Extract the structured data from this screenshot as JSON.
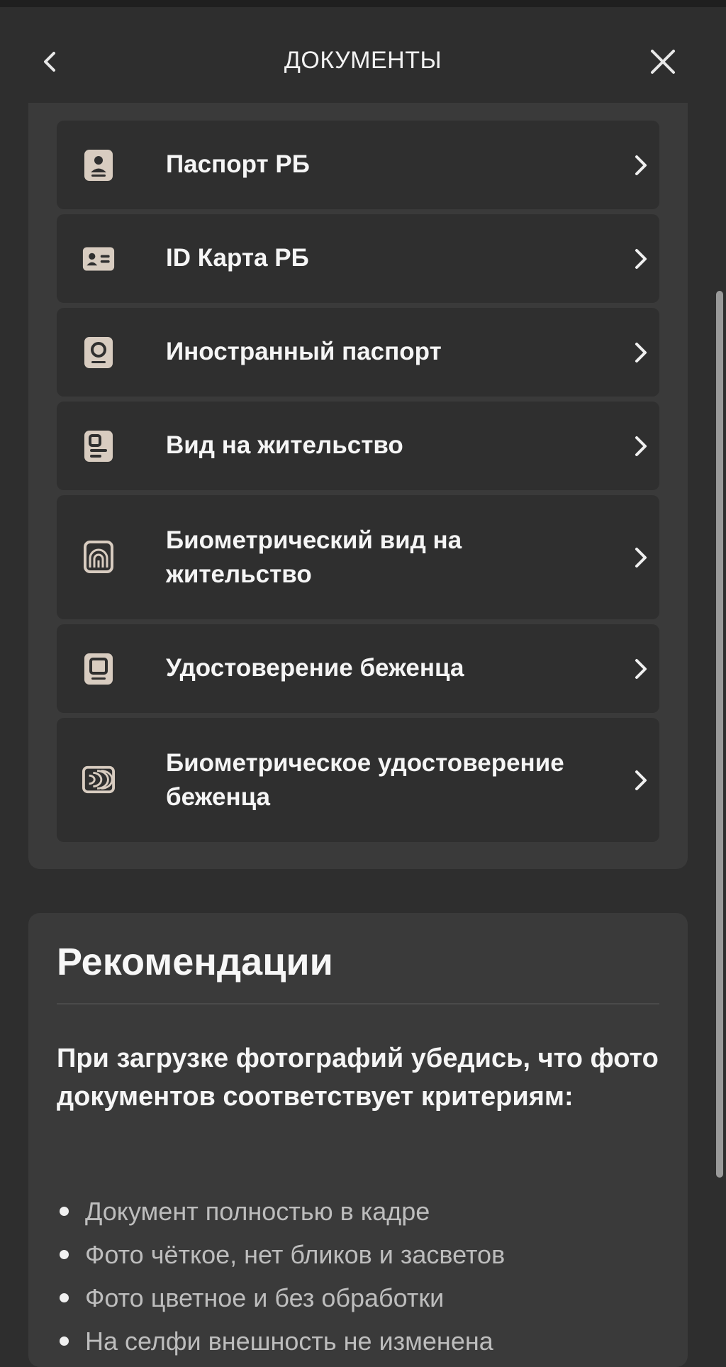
{
  "header": {
    "title": "ДОКУМЕНТЫ",
    "back_icon": "chevron-left-icon",
    "close_icon": "close-icon"
  },
  "documents": {
    "items": [
      {
        "label": "Паспорт РБ",
        "icon": "passport-icon"
      },
      {
        "label": "ID Карта РБ",
        "icon": "id-card-icon"
      },
      {
        "label": "Иностранный паспорт",
        "icon": "foreign-passport-icon"
      },
      {
        "label": "Вид на жительство",
        "icon": "residence-permit-icon"
      },
      {
        "label": "Биометрический вид на жительство",
        "icon": "biometric-residence-permit-icon"
      },
      {
        "label": "Удостоверение беженца",
        "icon": "refugee-certificate-icon"
      },
      {
        "label": "Биометрическое удостоверение беженца",
        "icon": "biometric-refugee-certificate-icon"
      }
    ]
  },
  "recommendations": {
    "title": "Рекомендации",
    "intro": "При загрузке фотографий убедись, что фото документов соответствует критериям:",
    "criteria": [
      "Документ полностью в кадре",
      "Фото чёткое, нет бликов и засветов",
      "Фото цветное и без обработки",
      "На селфи внешность не изменена"
    ]
  },
  "colors": {
    "background": "#2e2e2e",
    "panel": "#3a3a3a",
    "item": "#2f2f2f",
    "icon": "#d8ccc0",
    "text": "#f5f5f5",
    "muted_text": "#bdbdbd"
  }
}
